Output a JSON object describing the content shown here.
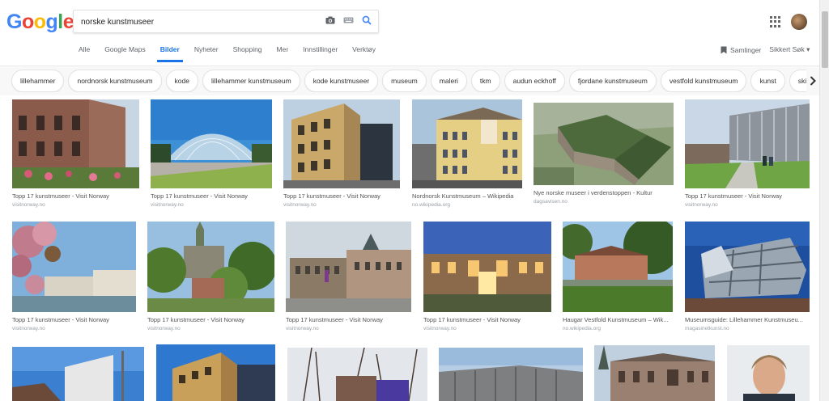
{
  "logo": {
    "letters": [
      "G",
      "o",
      "o",
      "g",
      "l",
      "e"
    ],
    "colors": [
      "#4285f4",
      "#ea4335",
      "#fbbc05",
      "#4285f4",
      "#34a853",
      "#ea4335"
    ]
  },
  "search": {
    "value": "norske kunstmuseer",
    "camera_icon": "camera-icon",
    "keyboard_icon": "keyboard-icon",
    "search_icon": "search-icon"
  },
  "header": {
    "apps_icon": "apps-grid-icon",
    "avatar": "user-avatar"
  },
  "tabs": [
    {
      "label": "Alle",
      "active": false
    },
    {
      "label": "Google Maps",
      "active": false
    },
    {
      "label": "Bilder",
      "active": true
    },
    {
      "label": "Nyheter",
      "active": false
    },
    {
      "label": "Shopping",
      "active": false
    },
    {
      "label": "Mer",
      "active": false
    },
    {
      "label": "Innstillinger",
      "active": false
    },
    {
      "label": "Verktøy",
      "active": false
    }
  ],
  "right_links": {
    "collections": "Samlinger",
    "safe_search": "Sikkert Søk ▾"
  },
  "chips": [
    "lillehammer",
    "nordnorsk kunstmuseum",
    "kode",
    "lillehammer kunstmuseum",
    "kode kunstmuseer",
    "museum",
    "maleri",
    "tkm",
    "audun eckhoff",
    "fjordane kunstmuseum",
    "vestfold kunstmuseum",
    "kunst",
    "skipbrudd ved"
  ],
  "colors": {
    "accent": "#1a73e8",
    "chip_bg": "#f8f8f8"
  },
  "results": [
    {
      "title": "Topp 17 kunstmuseer - Visit Norway",
      "source": "visitnorway.no"
    },
    {
      "title": "Topp 17 kunstmuseer - Visit Norway",
      "source": "visitnorway.no"
    },
    {
      "title": "Topp 17 kunstmuseer - Visit Norway",
      "source": "visitnorway.no"
    },
    {
      "title": "Nordnorsk Kunstmuseum – Wikipedia",
      "source": "no.wikipedia.org"
    },
    {
      "title": "Nye norske museer i verdenstoppen - Kultur",
      "source": "dagsavisen.no"
    },
    {
      "title": "Topp 17 kunstmuseer - Visit Norway",
      "source": "visitnorway.no"
    },
    {
      "title": "Topp 17 kunstmuseer - Visit Norway",
      "source": "visitnorway.no"
    },
    {
      "title": "Topp 17 kunstmuseer - Visit Norway",
      "source": "visitnorway.no"
    },
    {
      "title": "Topp 17 kunstmuseer - Visit Norway",
      "source": "visitnorway.no"
    },
    {
      "title": "Topp 17 kunstmuseer - Visit Norway",
      "source": "visitnorway.no"
    },
    {
      "title": "Haugar Vestfold Kunstmuseum – Wik...",
      "source": "no.wikipedia.org"
    },
    {
      "title": "Museumsguide: Lillehammer Kunstmuseu...",
      "source": "magasinetkunst.no"
    },
    {
      "title": "",
      "source": ""
    },
    {
      "title": "",
      "source": ""
    },
    {
      "title": "",
      "source": ""
    },
    {
      "title": "",
      "source": ""
    },
    {
      "title": "",
      "source": ""
    },
    {
      "title": "",
      "source": ""
    }
  ]
}
